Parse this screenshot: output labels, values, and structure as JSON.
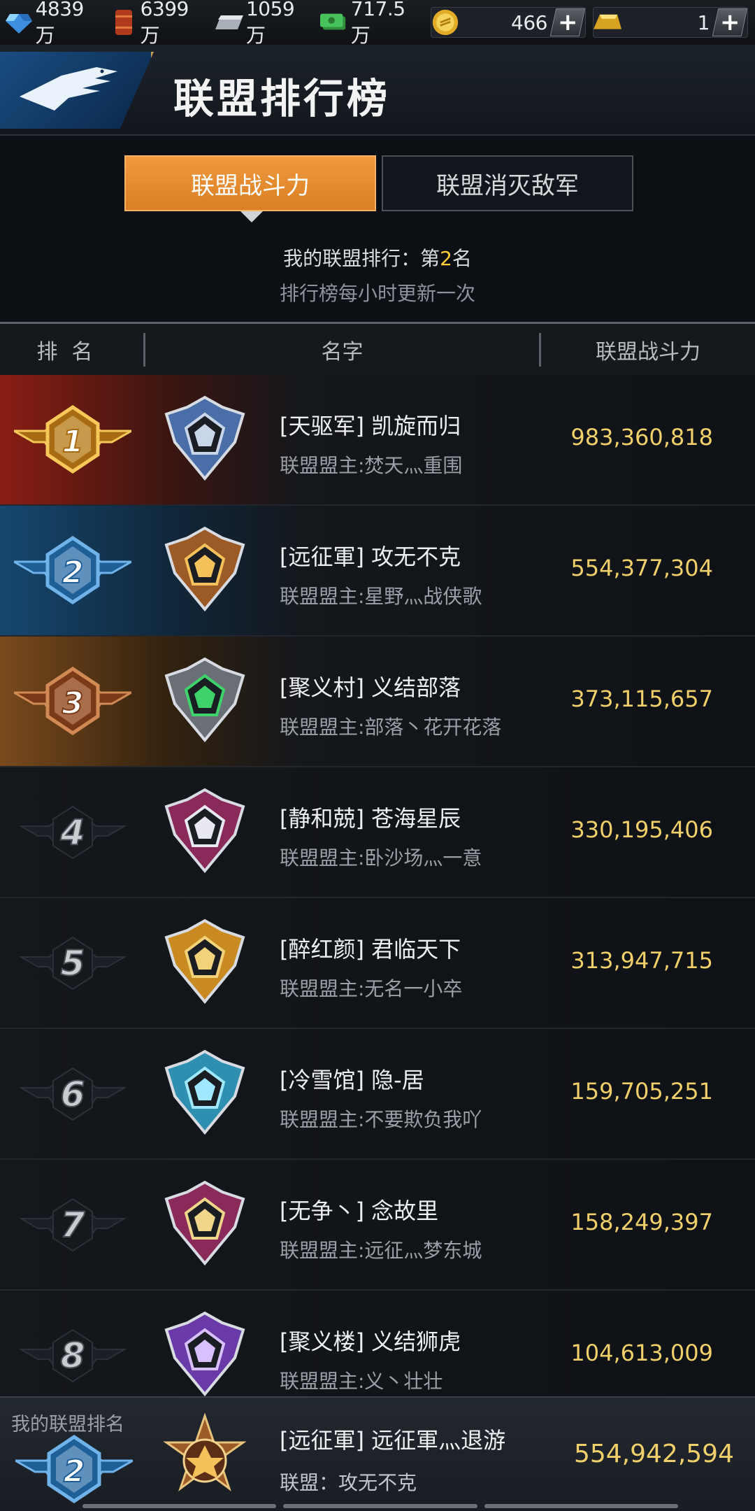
{
  "resources": [
    {
      "name": "crystal",
      "icon": "crystal-icon",
      "value": "4839万"
    },
    {
      "name": "oil",
      "icon": "oil-barrel-icon",
      "value": "6399万"
    },
    {
      "name": "steel",
      "icon": "steel-bar-icon",
      "value": "1059万"
    },
    {
      "name": "cash",
      "icon": "cash-icon",
      "value": "717.5万"
    },
    {
      "name": "coin",
      "icon": "gold-coin-icon",
      "value": "466"
    },
    {
      "name": "gold",
      "icon": "gold-bar-icon",
      "value": "1"
    }
  ],
  "header": {
    "title": "联盟排行榜"
  },
  "tabs": [
    {
      "label": "联盟战斗力",
      "active": true
    },
    {
      "label": "联盟消灭敌军",
      "active": false
    }
  ],
  "my_rank_text": {
    "prefix": "我的联盟排行：第",
    "rank": "2",
    "suffix": "名"
  },
  "update_note": "排行榜每小时更新一次",
  "columns": {
    "rank": "排名",
    "name": "名字",
    "power": "联盟战斗力"
  },
  "rows": [
    {
      "rank": "1",
      "name": "[天驱军] 凯旋而归",
      "leader": "联盟盟主:焚天灬重围",
      "power": "983,360,818"
    },
    {
      "rank": "2",
      "name": "[远征軍] 攻无不克",
      "leader": "联盟盟主:星野灬战侠歌",
      "power": "554,377,304"
    },
    {
      "rank": "3",
      "name": "[聚义村] 义结部落",
      "leader": "联盟盟主:部落丶花开花落",
      "power": "373,115,657"
    },
    {
      "rank": "4",
      "name": "[静和兢] 苍海星辰",
      "leader": "联盟盟主:卧沙场灬一意",
      "power": "330,195,406"
    },
    {
      "rank": "5",
      "name": "[醉红颜] 君临天下",
      "leader": "联盟盟主:无名一小卒",
      "power": "313,947,715"
    },
    {
      "rank": "6",
      "name": "[冷雪馆] 隐-居",
      "leader": "联盟盟主:不要欺负我吖",
      "power": "159,705,251"
    },
    {
      "rank": "7",
      "name": "[无争丶] 念故里",
      "leader": "联盟盟主:远征灬梦东城",
      "power": "158,249,397"
    },
    {
      "rank": "8",
      "name": "[聚义楼] 义结狮虎",
      "leader": "联盟盟主:义丶壮壮",
      "power": "104,613,009"
    }
  ],
  "my_panel": {
    "label": "我的联盟排名",
    "rank": "2",
    "name": "[远征軍] 远征軍灬退游",
    "alliance": "联盟：攻无不克",
    "power": "554,942,594"
  },
  "colors": {
    "accent": "#e88a2e",
    "power": "#f1cf6a",
    "rank_highlight": "#ffcf3a"
  }
}
